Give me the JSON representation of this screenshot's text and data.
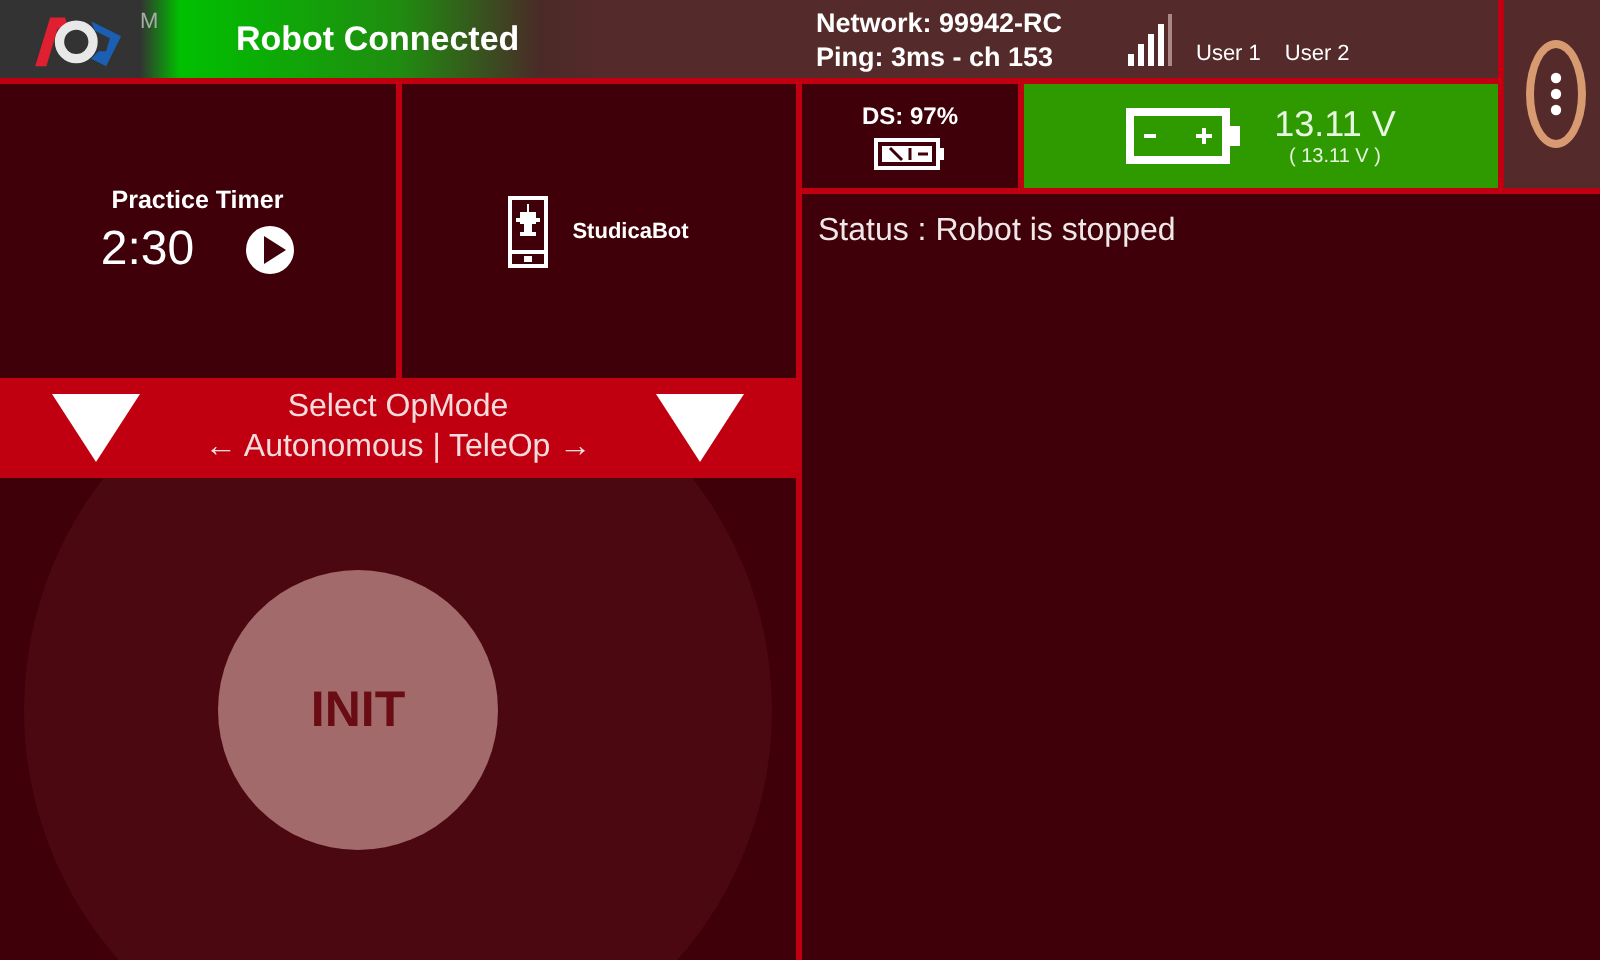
{
  "header": {
    "mode_letter": "M",
    "connection": "Robot Connected",
    "network": "Network: 99942-RC",
    "ping": "Ping: 3ms - ch 153",
    "users": [
      "User 1",
      "User 2"
    ]
  },
  "driver_station": {
    "label": "DS: 97%"
  },
  "robot_battery": {
    "voltage": "13.11 V",
    "reading": "( 13.11 V )"
  },
  "timer": {
    "title": "Practice Timer",
    "time": "2:30"
  },
  "robot": {
    "name": "StudicaBot"
  },
  "opmode": {
    "title": "Select OpMode",
    "options": "← Autonomous | TeleOp →"
  },
  "init_button": {
    "label": "INIT"
  },
  "status": "Status : Robot is stopped"
}
